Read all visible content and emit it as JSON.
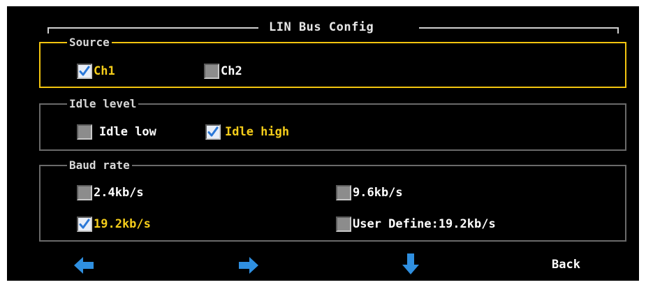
{
  "title": "LIN Bus Config",
  "colors": {
    "accent": "#f2c40f",
    "checked_text": "#f5cd1a",
    "arrow": "#2f8fe0",
    "background": "#000000"
  },
  "source": {
    "legend": "Source",
    "options": [
      {
        "label": "Ch1",
        "checked": true
      },
      {
        "label": "Ch2",
        "checked": false
      }
    ]
  },
  "idle_level": {
    "legend": "Idle level",
    "options": [
      {
        "label": "Idle low",
        "checked": false
      },
      {
        "label": "Idle high",
        "checked": true
      }
    ]
  },
  "baud_rate": {
    "legend": "Baud rate",
    "options": [
      {
        "label": "2.4kb/s",
        "checked": false
      },
      {
        "label": "9.6kb/s",
        "checked": false
      },
      {
        "label": "19.2kb/s",
        "checked": true
      },
      {
        "label": "User Define:19.2kb/s",
        "checked": false
      }
    ]
  },
  "footer": {
    "icons": [
      "arrow-left-icon",
      "arrow-right-icon",
      "arrow-down-icon"
    ],
    "back_label": "Back"
  }
}
